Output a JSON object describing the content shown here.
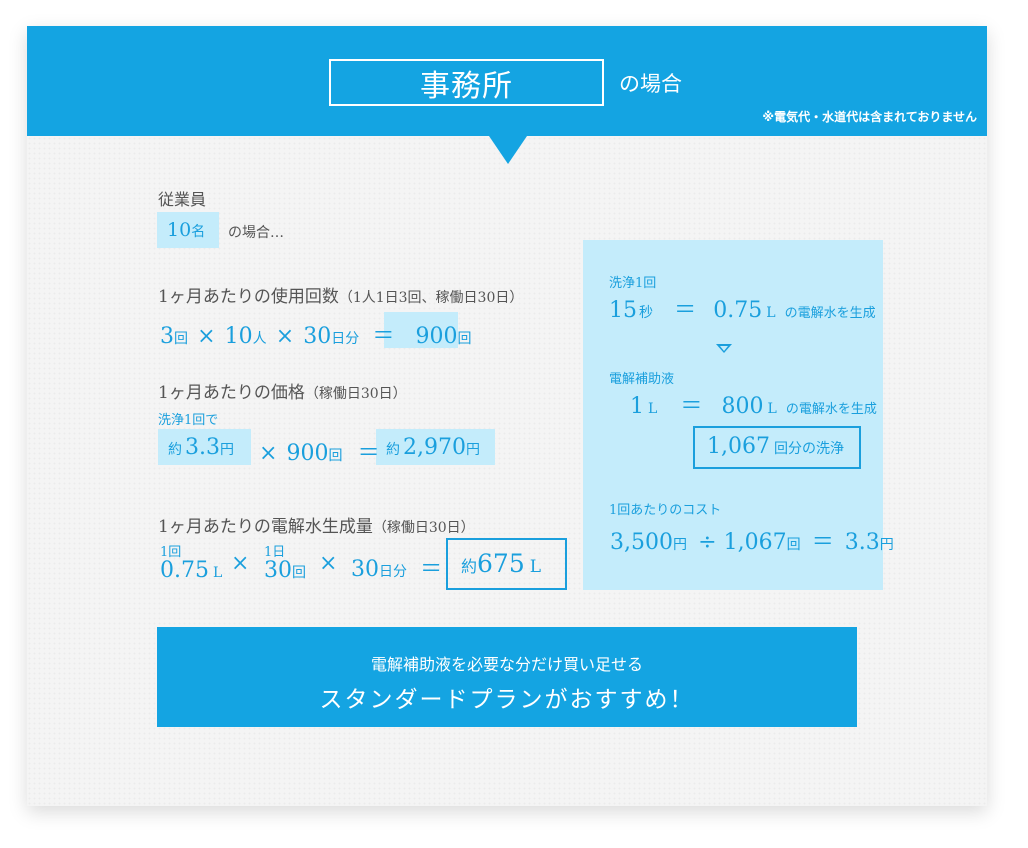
{
  "header": {
    "title": "事務所",
    "title_suffix": "の場合",
    "note": "※電気代・水道代は含まれておりません"
  },
  "employees": {
    "label": "従業員",
    "count": "10",
    "count_unit": "名",
    "suffix": "の場合…"
  },
  "usage": {
    "heading": "1ヶ月あたりの使用回数",
    "heading_note": "（1人1日3回、稼働日30日）",
    "v1": "3",
    "u1": "回",
    "times": "×",
    "v2": "10",
    "u2": "人",
    "v3": "30",
    "u3": "日分",
    "eq": "＝",
    "result": "900",
    "result_unit": "回"
  },
  "price": {
    "heading": "1ヶ月あたりの価格",
    "heading_note": "（稼働日30日）",
    "sublabel": "洗浄1回で",
    "pre": "約",
    "v1": "3.3",
    "u1": "円",
    "times": "×",
    "v2": "900",
    "u2": "回",
    "eq": "＝",
    "result": "2,970",
    "result_unit": "円"
  },
  "water": {
    "heading": "1ヶ月あたりの電解水生成量",
    "heading_note": "（稼働日30日）",
    "label1": "1回",
    "v1": "0.75",
    "u1": "L",
    "times": "×",
    "label2": "1日",
    "v2": "30",
    "u2": "回",
    "v3": "30",
    "u3": "日分",
    "eq": "＝",
    "result_pre": "約",
    "result": "675",
    "result_unit": "L"
  },
  "side": {
    "wash_label": "洗浄1回",
    "wash_sec": "15",
    "wash_sec_unit": "秒",
    "eq": "＝",
    "wash_l": "0.75",
    "wash_l_unit": "L",
    "gen_text": "の電解水を生成",
    "liquid_label": "電解補助液",
    "liq_v": "1",
    "liq_unit": "L",
    "liq_out": "800",
    "liq_out_unit": "L",
    "count": "1,067",
    "count_text": "回分の洗浄",
    "cost_label": "1回あたりのコスト",
    "cost1": "3,500",
    "cost1_unit": "円",
    "div": "÷",
    "cost2": "1,067",
    "cost2_unit": "回",
    "cost_eq": "＝",
    "cost3": "3.3",
    "cost3_unit": "円"
  },
  "cta": {
    "line1": "電解補助液を必要な分だけ買い足せる",
    "line2": "スタンダードプランがおすすめ！"
  },
  "colors": {
    "accent": "#14a4e2",
    "highlight": "#c4ecfb",
    "text": "#555555"
  }
}
